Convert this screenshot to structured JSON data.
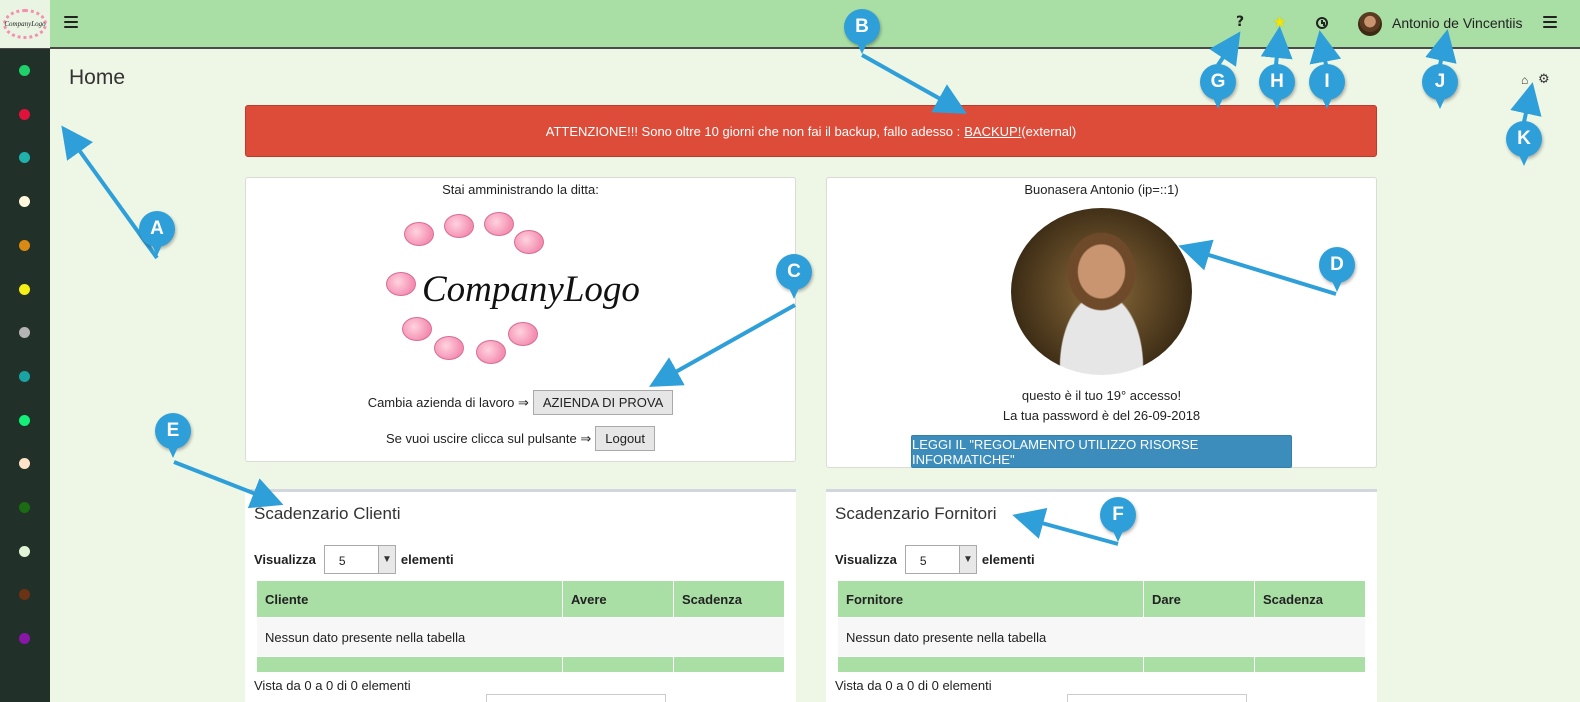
{
  "topbar": {
    "logo_text": "CompanyLogo",
    "help_icon": "question-icon",
    "favorites_icon": "star-icon",
    "history_icon": "clock-icon",
    "user_name": "Antonio de Vincentiis"
  },
  "sidebar": {
    "dots": [
      "#1fd16b",
      "#e0123b",
      "#20b2aa",
      "#fff8dc",
      "#d98a12",
      "#f5ef16",
      "#b4b4b4",
      "#1aa3a3",
      "#12f07a",
      "#fde1c8",
      "#1a6b12",
      "#dff5d6",
      "#6b3314",
      "#8a16a8"
    ]
  },
  "page": {
    "title": "Home",
    "breadcrumb_home_icon": "home-icon",
    "breadcrumb_settings_icon": "gear-icon"
  },
  "alert": {
    "text": "ATTENZIONE!!! Sono oltre 10 giorni che non fai il backup, fallo adesso :",
    "link": "BACKUP!",
    "suffix": "(external)"
  },
  "company_card": {
    "heading": "Stai amministrando la ditta:",
    "logo_text": "CompanyLogo",
    "change_label": "Cambia azienda di lavoro ⇒",
    "company_button": "AZIENDA DI PROVA",
    "logout_label": "Se vuoi uscire clicca sul pulsante ⇒",
    "logout_button": "Logout"
  },
  "user_card": {
    "greeting": "Buonasera Antonio (ip=::1)",
    "access_count": "questo è il tuo 19° accesso!",
    "password_date": "La tua password è del 26-09-2018",
    "rules_button": "LEGGI IL \"REGOLAMENTO UTILIZZO RISORSE INFORMATICHE\""
  },
  "clients_box": {
    "title": "Scadenzario Clienti",
    "show_label": "Visualizza",
    "page_size": "5",
    "elements_label": "elementi",
    "columns": [
      "Cliente",
      "Avere",
      "Scadenza"
    ],
    "empty_text": "Nessun dato presente nella tabella",
    "info": "Vista da 0 a 0 di 0 elementi"
  },
  "suppliers_box": {
    "title": "Scadenzario Fornitori",
    "show_label": "Visualizza",
    "page_size": "5",
    "elements_label": "elementi",
    "columns": [
      "Fornitore",
      "Dare",
      "Scadenza"
    ],
    "empty_text": "Nessun dato presente nella tabella",
    "info": "Vista da 0 a 0 di 0 elementi"
  },
  "callouts": [
    "A",
    "B",
    "C",
    "D",
    "E",
    "F",
    "G",
    "H",
    "I",
    "J",
    "K"
  ]
}
